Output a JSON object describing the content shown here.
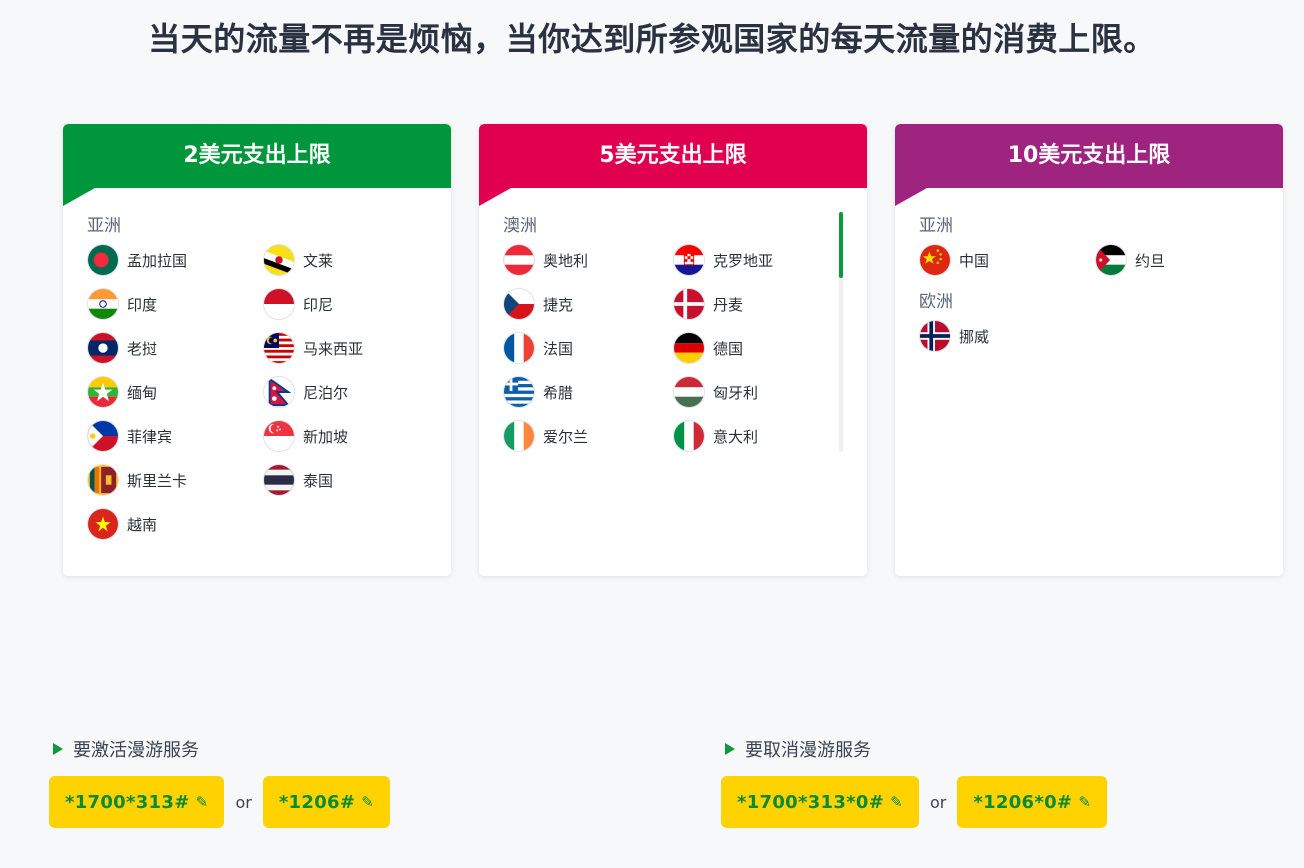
{
  "title": "当天的流量不再是烦恼，当你达到所参观国家的每天流量的消费上限。",
  "plans": [
    {
      "label": "2美元支出上限",
      "color": "#00963b",
      "regions": [
        {
          "name": "亚洲",
          "countries": [
            {
              "name": "孟加拉国",
              "flag": "bangladesh-flag"
            },
            {
              "name": "文莱",
              "flag": "brunei-flag"
            },
            {
              "name": "印度",
              "flag": "india-flag"
            },
            {
              "name": "印尼",
              "flag": "indonesia-flag"
            },
            {
              "name": "老挝",
              "flag": "laos-flag"
            },
            {
              "name": "马来西亚",
              "flag": "malaysia-flag"
            },
            {
              "name": "缅甸",
              "flag": "myanmar-flag"
            },
            {
              "name": "尼泊尔",
              "flag": "nepal-flag"
            },
            {
              "name": "菲律宾",
              "flag": "philippines-flag"
            },
            {
              "name": "新加坡",
              "flag": "singapore-flag"
            },
            {
              "name": "斯里兰卡",
              "flag": "sri-lanka-flag"
            },
            {
              "name": "泰国",
              "flag": "thailand-flag"
            },
            {
              "name": "越南",
              "flag": "vietnam-flag"
            }
          ]
        }
      ]
    },
    {
      "label": "5美元支出上限",
      "color": "#e0004d",
      "regions": [
        {
          "name": "澳洲",
          "countries": [
            {
              "name": "奥地利",
              "flag": "austria-flag"
            },
            {
              "name": "克罗地亚",
              "flag": "croatia-flag"
            },
            {
              "name": "捷克",
              "flag": "czech-flag"
            },
            {
              "name": "丹麦",
              "flag": "denmark-flag"
            },
            {
              "name": "法国",
              "flag": "france-flag"
            },
            {
              "name": "德国",
              "flag": "germany-flag"
            },
            {
              "name": "希腊",
              "flag": "greece-flag"
            },
            {
              "name": "匈牙利",
              "flag": "hungary-flag"
            },
            {
              "name": "爱尔兰",
              "flag": "ireland-flag"
            },
            {
              "name": "意大利",
              "flag": "italy-flag"
            }
          ]
        }
      ]
    },
    {
      "label": "10美元支出上限",
      "color": "#9e2480",
      "regions": [
        {
          "name": "亚洲",
          "countries": [
            {
              "name": "中国",
              "flag": "china-flag"
            },
            {
              "name": "约旦",
              "flag": "jordan-flag"
            }
          ]
        },
        {
          "name": "欧洲",
          "countries": [
            {
              "name": "挪威",
              "flag": "norway-flag"
            }
          ]
        }
      ]
    }
  ],
  "activate": {
    "label": "要激活漫游服务",
    "codes": [
      "*1700*313#",
      "*1206#"
    ],
    "or": "or"
  },
  "deactivate": {
    "label": "要取消漫游服务",
    "codes": [
      "*1700*313*0#",
      "*1206*0#"
    ],
    "or": "or"
  },
  "icons": {
    "dial": "pencil-icon",
    "bullet": "triangle-arrow-icon"
  }
}
